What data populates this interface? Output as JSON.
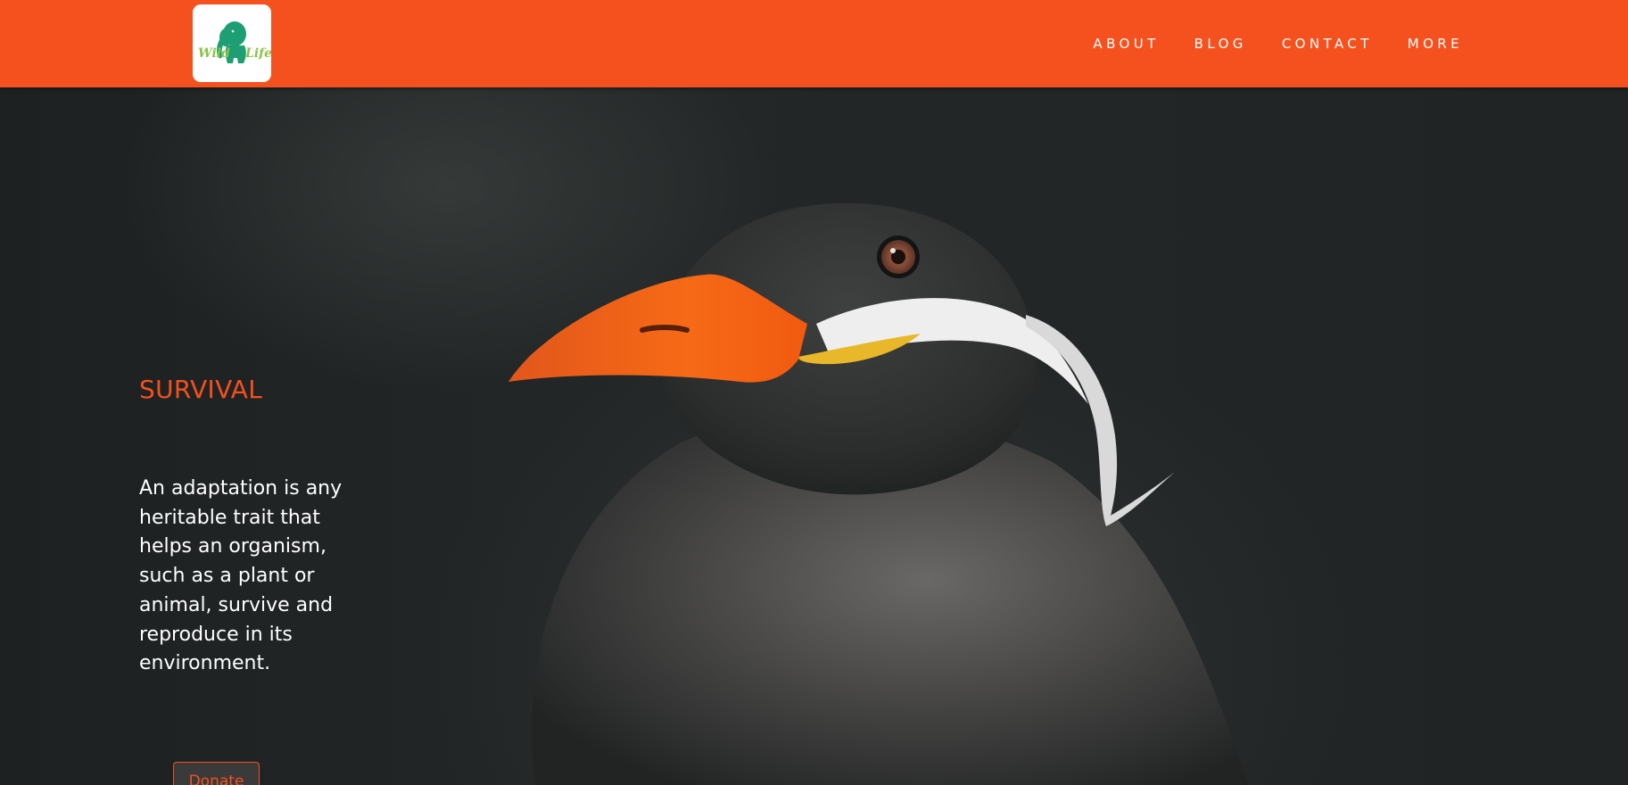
{
  "brand": {
    "accent_color": "#f4511e",
    "logo": {
      "icon": "elephant-icon",
      "text_left": "Wild",
      "text_right": "Life",
      "icon_color": "#1e9e73",
      "text_color": "#8bc34a"
    }
  },
  "nav": {
    "items": [
      {
        "label": "ABOUT"
      },
      {
        "label": "BLOG"
      },
      {
        "label": "CONTACT"
      },
      {
        "label": "MORE"
      }
    ]
  },
  "hero": {
    "image": "tern-bird-photo",
    "title": "SURVIVAL",
    "text": "An adaptation is any heritable trait that helps an organism, such as a plant or animal, survive and reproduce in its environment.",
    "donate_label": "Donate"
  }
}
